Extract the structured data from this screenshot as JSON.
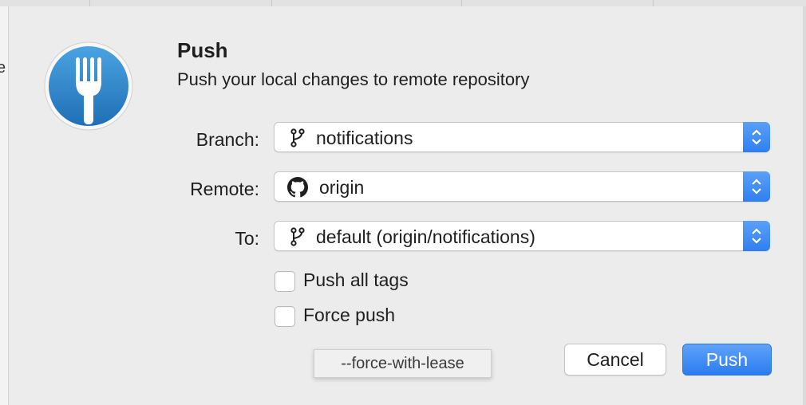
{
  "dialog": {
    "title": "Push",
    "subtitle": "Push your local changes to remote repository"
  },
  "background": {
    "partial_text": "e"
  },
  "fields": {
    "branch": {
      "label": "Branch:",
      "value": "notifications",
      "icon": "branch-icon"
    },
    "remote": {
      "label": "Remote:",
      "value": "origin",
      "icon": "github-icon"
    },
    "to": {
      "label": "To:",
      "value": "default (origin/notifications)",
      "icon": "branch-icon"
    }
  },
  "options": {
    "push_all_tags": {
      "label": "Push all tags",
      "checked": false
    },
    "force_push": {
      "label": "Force push",
      "checked": false
    }
  },
  "tooltip": "--force-with-lease",
  "buttons": {
    "cancel": "Cancel",
    "push": "Push"
  },
  "colors": {
    "accent": "#2f7ff0",
    "app_icon_blue": "#2f86c8",
    "background": "#ececec"
  }
}
